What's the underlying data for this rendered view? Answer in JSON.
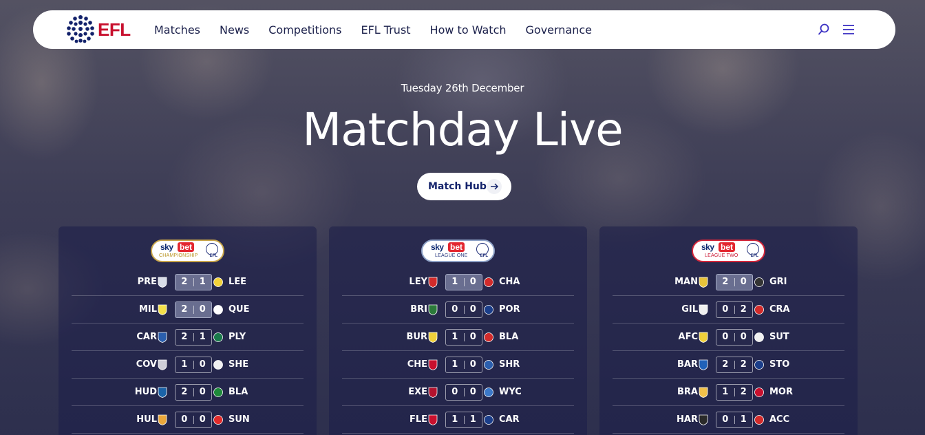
{
  "nav": {
    "logo_text": "EFL",
    "links": [
      "Matches",
      "News",
      "Competitions",
      "EFL Trust",
      "How to Watch",
      "Governance"
    ],
    "search_icon": "search-icon",
    "menu_icon": "menu-icon",
    "accent": "#1a1f4a",
    "brand": "#c8102e"
  },
  "hero": {
    "date": "Tuesday 26th December",
    "title": "Matchday Live",
    "button_label": "Match Hub"
  },
  "competitions": [
    {
      "sponsor": "sky",
      "sponsor_bet": "bet",
      "name": "CHAMPIONSHIP",
      "efl": "EFL",
      "matches": [
        {
          "home": "PRE",
          "home_score": "2",
          "away_score": "1",
          "away": "LEE",
          "live": true
        },
        {
          "home": "MIL",
          "home_score": "2",
          "away_score": "0",
          "away": "QUE",
          "live": true
        },
        {
          "home": "CAR",
          "home_score": "2",
          "away_score": "1",
          "away": "PLY",
          "live": false
        },
        {
          "home": "COV",
          "home_score": "1",
          "away_score": "0",
          "away": "SHE",
          "live": false
        },
        {
          "home": "HUD",
          "home_score": "2",
          "away_score": "0",
          "away": "BLA",
          "live": false
        },
        {
          "home": "HUL",
          "home_score": "0",
          "away_score": "0",
          "away": "SUN",
          "live": false
        }
      ]
    },
    {
      "sponsor": "sky",
      "sponsor_bet": "bet",
      "name": "LEAGUE ONE",
      "efl": "EFL",
      "matches": [
        {
          "home": "LEY",
          "home_score": "1",
          "away_score": "0",
          "away": "CHA",
          "live": true
        },
        {
          "home": "BRI",
          "home_score": "0",
          "away_score": "0",
          "away": "POR",
          "live": false
        },
        {
          "home": "BUR",
          "home_score": "1",
          "away_score": "0",
          "away": "BLA",
          "live": false
        },
        {
          "home": "CHE",
          "home_score": "1",
          "away_score": "0",
          "away": "SHR",
          "live": false
        },
        {
          "home": "EXE",
          "home_score": "0",
          "away_score": "0",
          "away": "WYC",
          "live": false
        },
        {
          "home": "FLE",
          "home_score": "1",
          "away_score": "1",
          "away": "CAR",
          "live": false
        }
      ]
    },
    {
      "sponsor": "sky",
      "sponsor_bet": "bet",
      "name": "LEAGUE TWO",
      "efl": "EFL",
      "matches": [
        {
          "home": "MAN",
          "home_score": "2",
          "away_score": "0",
          "away": "GRI",
          "live": true
        },
        {
          "home": "GIL",
          "home_score": "0",
          "away_score": "2",
          "away": "CRA",
          "live": false
        },
        {
          "home": "AFC",
          "home_score": "0",
          "away_score": "0",
          "away": "SUT",
          "live": false
        },
        {
          "home": "BAR",
          "home_score": "2",
          "away_score": "2",
          "away": "STO",
          "live": false
        },
        {
          "home": "BRA",
          "home_score": "1",
          "away_score": "2",
          "away": "MOR",
          "live": false
        },
        {
          "home": "HAR",
          "home_score": "0",
          "away_score": "1",
          "away": "ACC",
          "live": false
        }
      ]
    }
  ]
}
